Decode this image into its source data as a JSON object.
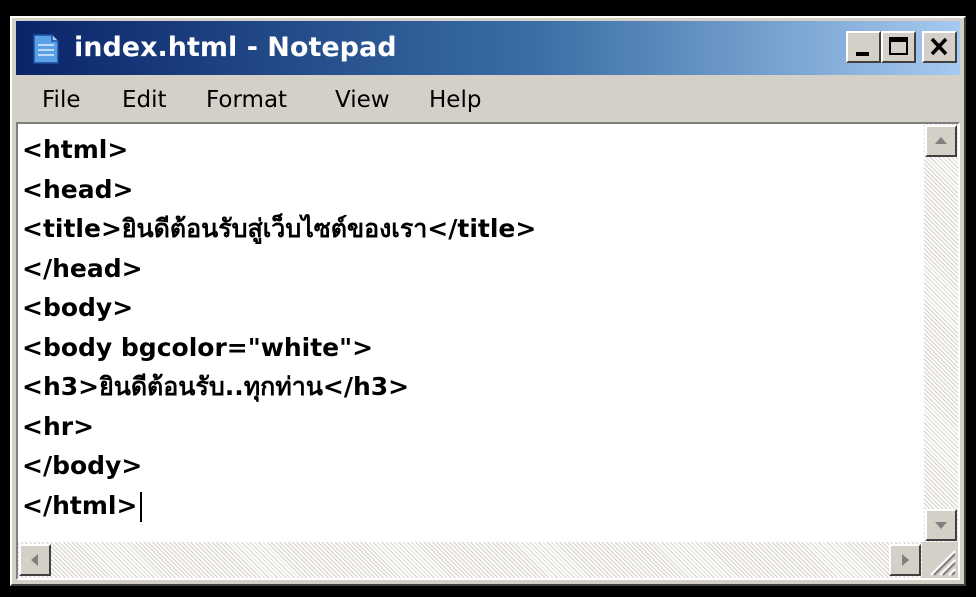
{
  "window": {
    "title": "index.html - Notepad",
    "controls": [
      "minimize",
      "maximize",
      "close"
    ]
  },
  "menu": [
    "File",
    "Edit",
    "Format",
    "View",
    "Help"
  ],
  "editor": {
    "lines": [
      "<html>",
      "<head>",
      "<title>ยินดีต้อนรับสู่เว็บไซต์ของเรา</title>",
      "</head>",
      "<body>",
      "<body bgcolor=\"white\">",
      "<h3>ยินดีต้อนรับ..ทุกท่าน</h3>",
      "<hr>",
      "</body>",
      "</html>"
    ]
  },
  "icons": {
    "app": "notepad-icon",
    "scroll_up": "arrow-up-icon",
    "scroll_down": "arrow-down-icon",
    "scroll_left": "arrow-left-icon",
    "scroll_right": "arrow-right-icon",
    "resize": "resize-grip-icon"
  },
  "colors": {
    "titlebar_start": "#0a246a",
    "titlebar_end": "#a6caf0",
    "chrome": "#d4d0c8",
    "editor_bg": "#ffffff",
    "text": "#000000"
  }
}
